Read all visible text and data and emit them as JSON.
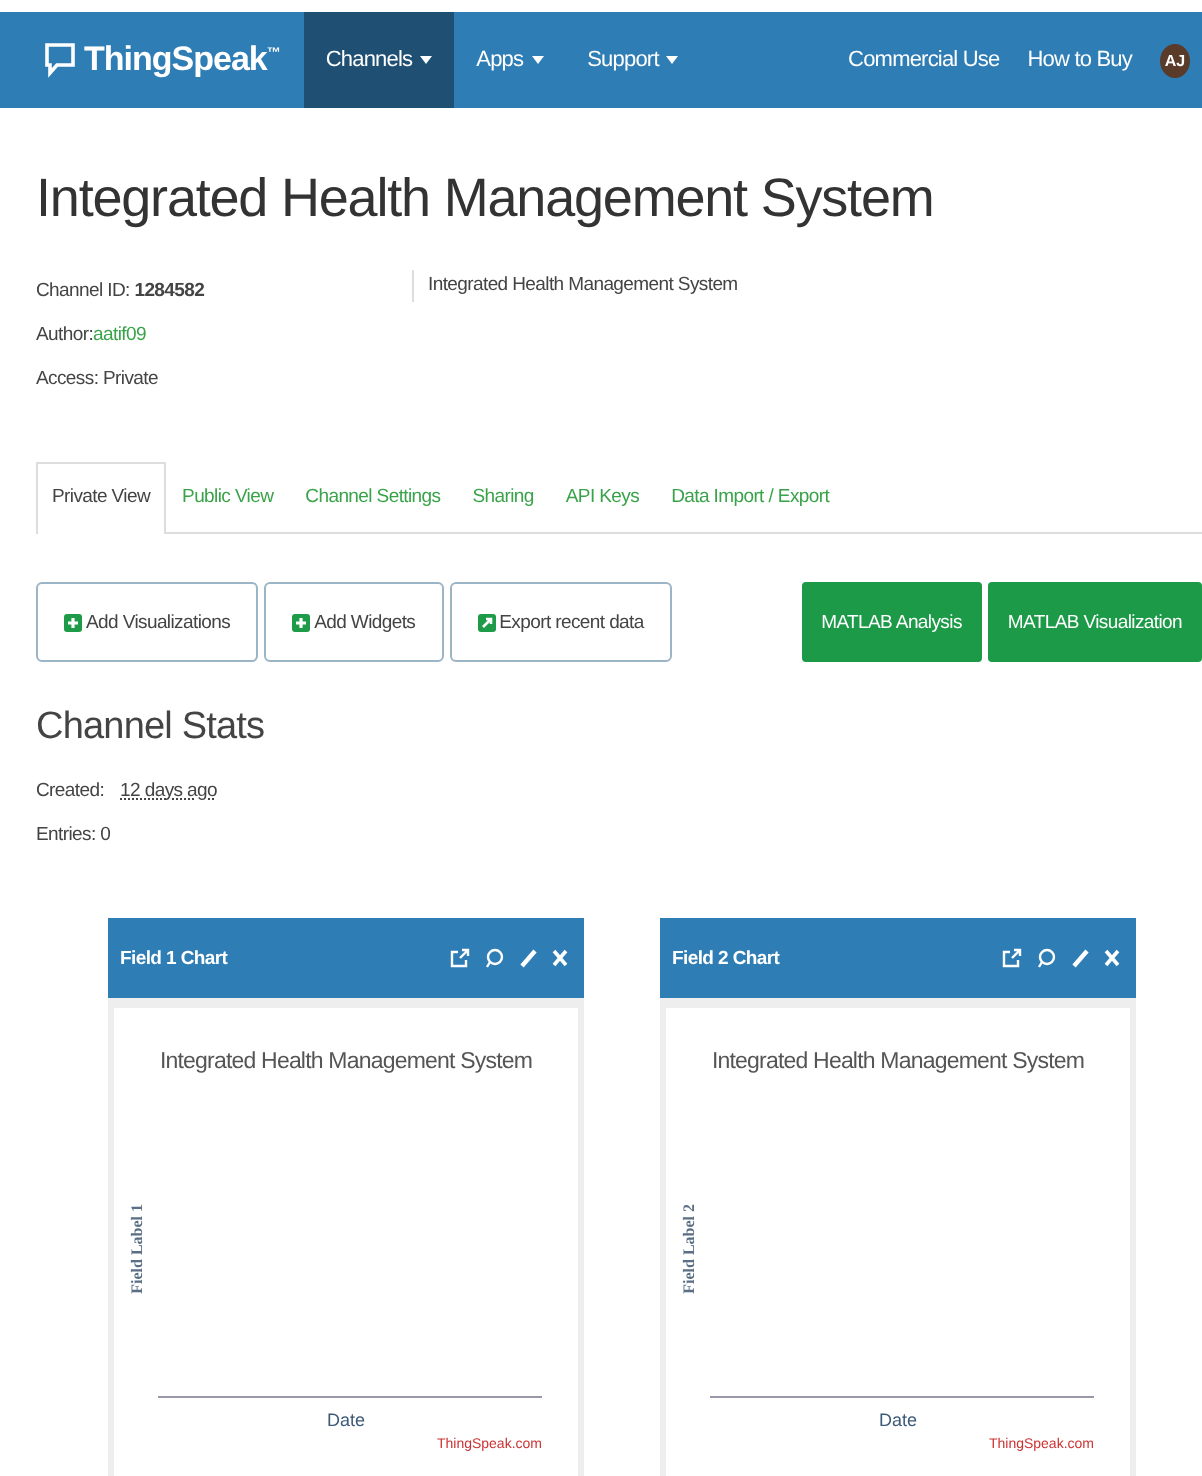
{
  "navbar": {
    "brand": "ThingSpeak",
    "trademark": "™",
    "menu": [
      {
        "label": "Channels",
        "selected": true,
        "caret": true
      },
      {
        "label": "Apps",
        "selected": false,
        "caret": true
      },
      {
        "label": "Support",
        "selected": false,
        "caret": true
      }
    ],
    "right_links": [
      "Commercial Use",
      "How to Buy"
    ],
    "avatar": "AJ"
  },
  "channel": {
    "title": "Integrated Health Management System",
    "id_label": "Channel ID:",
    "id": "1284582",
    "author_label": "Author:",
    "author": "aatif09",
    "access": "Access: Private",
    "description": "Integrated Health Management System"
  },
  "tabs": [
    {
      "label": "Private View",
      "selected": true
    },
    {
      "label": "Public View",
      "selected": false
    },
    {
      "label": "Channel Settings",
      "selected": false
    },
    {
      "label": "Sharing",
      "selected": false
    },
    {
      "label": "API Keys",
      "selected": false
    },
    {
      "label": "Data Import / Export",
      "selected": false
    }
  ],
  "actions": [
    {
      "label": "Add Visualizations",
      "kind": "plus"
    },
    {
      "label": "Add Widgets",
      "kind": "plus"
    },
    {
      "label": "Export recent data",
      "kind": "export"
    }
  ],
  "matlab_buttons": [
    "MATLAB Analysis",
    "MATLAB Visualization"
  ],
  "stats": {
    "heading": "Channel Stats",
    "created_label": "Created:",
    "created": "12 days ago",
    "entries": "Entries: 0"
  },
  "charts": [
    {
      "header": "Field 1 Chart",
      "title": "Integrated Health Management System",
      "ylabel": "Field Label 1",
      "xlabel": "Date",
      "credit": "ThingSpeak.com"
    },
    {
      "header": "Field 2 Chart",
      "title": "Integrated Health Management System",
      "ylabel": "Field Label 2",
      "xlabel": "Date",
      "credit": "ThingSpeak.com"
    }
  ]
}
